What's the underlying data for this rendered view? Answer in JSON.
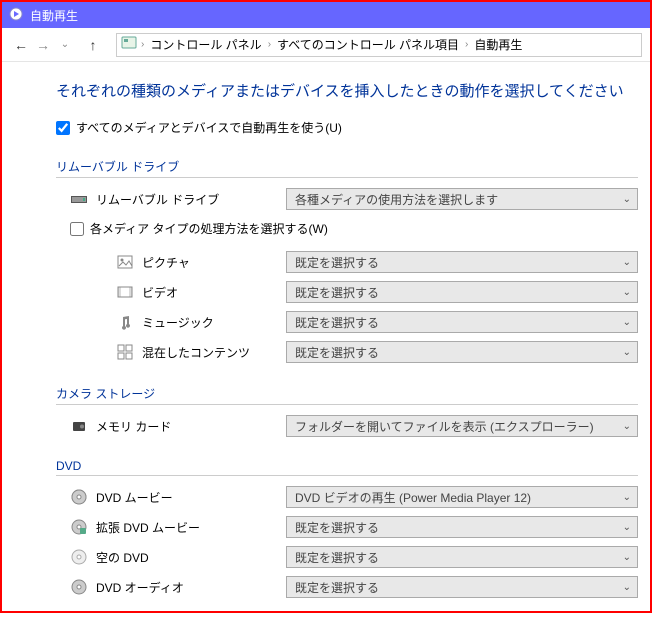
{
  "title": "自動再生",
  "breadcrumb": {
    "items": [
      "コントロール パネル",
      "すべてのコントロール パネル項目",
      "自動再生"
    ]
  },
  "heading": "それぞれの種類のメディアまたはデバイスを挿入したときの動作を選択してください",
  "checkbox_all": "すべてのメディアとデバイスで自動再生を使う(U)",
  "sections": {
    "removable": {
      "title": "リムーバブル ドライブ",
      "drive_label": "リムーバブル ドライブ",
      "drive_value": "各種メディアの使用方法を選択します",
      "sub_checkbox": "各メディア タイプの処理方法を選択する(W)",
      "items": [
        {
          "label": "ピクチャ",
          "value": "既定を選択する"
        },
        {
          "label": "ビデオ",
          "value": "既定を選択する"
        },
        {
          "label": "ミュージック",
          "value": "既定を選択する"
        },
        {
          "label": "混在したコンテンツ",
          "value": "既定を選択する"
        }
      ]
    },
    "camera": {
      "title": "カメラ ストレージ",
      "label": "メモリ カード",
      "value": "フォルダーを開いてファイルを表示 (エクスプローラー)"
    },
    "dvd": {
      "title": "DVD",
      "items": [
        {
          "label": "DVD ムービー",
          "value": "DVD ビデオの再生 (Power Media Player 12)"
        },
        {
          "label": "拡張 DVD ムービー",
          "value": "既定を選択する"
        },
        {
          "label": "空の DVD",
          "value": "既定を選択する"
        },
        {
          "label": "DVD オーディオ",
          "value": "既定を選択する"
        }
      ]
    }
  }
}
